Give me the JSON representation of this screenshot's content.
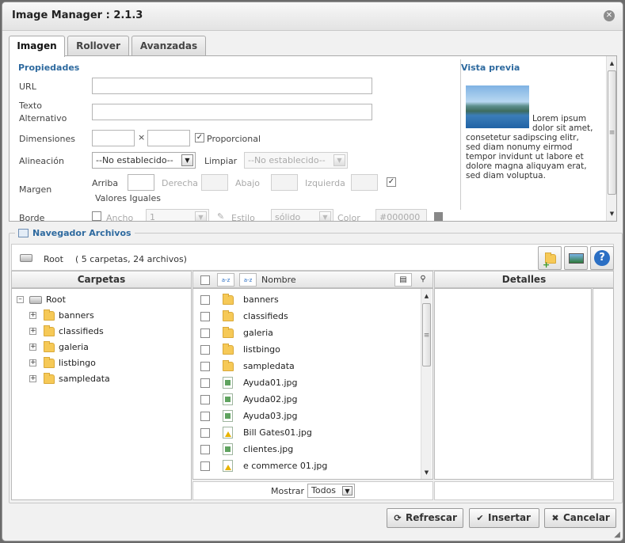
{
  "title": "Image Manager : 2.1.3",
  "tabs": [
    "Imagen",
    "Rollover",
    "Avanzadas"
  ],
  "props": {
    "section_title": "Propiedades",
    "url_label": "URL",
    "alt_label_1": "Texto",
    "alt_label_2": "Alternativo",
    "dims_label": "Dimensiones",
    "dims_sep": "×",
    "proportional_label": "Proporcional",
    "align_label": "Alineación",
    "align_value": "--No establecido--",
    "clear_label": "Limpiar",
    "clear_value": "--No establecido--",
    "margin_label": "Margen",
    "top_label": "Arriba",
    "right_label": "Derecha",
    "bottom_label": "Abajo",
    "left_label": "Izquierda",
    "equal_values_label": "Valores Iguales",
    "border_label": "Borde",
    "width_label": "Ancho",
    "width_value": "1",
    "style_label": "Estilo",
    "style_value": "sólido",
    "color_label": "Color",
    "color_value": "#000000"
  },
  "preview": {
    "title": "Vista previa",
    "text": "Lorem ipsum dolor sit amet, consetetur sadipscing elitr, sed diam nonumy eirmod tempor invidunt ut labore et dolore magna aliquyam erat, sed diam voluptua."
  },
  "browser": {
    "legend": "Navegador Archivos",
    "root_label": "Root",
    "summary": "( 5 carpetas, 24 archivos)",
    "folders_header": "Carpetas",
    "name_header": "Nombre",
    "details_header": "Detalles",
    "tree_root": "Root",
    "folders": [
      "banners",
      "classifieds",
      "galeria",
      "listbingo",
      "sampledata"
    ],
    "files": [
      {
        "name": "banners",
        "type": "folder"
      },
      {
        "name": "classifieds",
        "type": "folder"
      },
      {
        "name": "galeria",
        "type": "folder"
      },
      {
        "name": "listbingo",
        "type": "folder"
      },
      {
        "name": "sampledata",
        "type": "folder"
      },
      {
        "name": "Ayuda01.jpg",
        "type": "image"
      },
      {
        "name": "Ayuda02.jpg",
        "type": "image"
      },
      {
        "name": "Ayuda03.jpg",
        "type": "image"
      },
      {
        "name": "Bill Gates01.jpg",
        "type": "warn"
      },
      {
        "name": "clientes.jpg",
        "type": "image"
      },
      {
        "name": "e commerce 01.jpg",
        "type": "warn"
      }
    ],
    "show_label": "Mostrar",
    "show_value": "Todos"
  },
  "buttons": {
    "refresh": "Refrescar",
    "insert": "Insertar",
    "cancel": "Cancelar"
  },
  "colors": {
    "accent": "#2e6a9f",
    "folder": "#f6c957",
    "help": "#2b6fc4"
  },
  "icons": {
    "refresh": "refresh-icon",
    "insert": "check-icon",
    "cancel": "close-icon"
  }
}
